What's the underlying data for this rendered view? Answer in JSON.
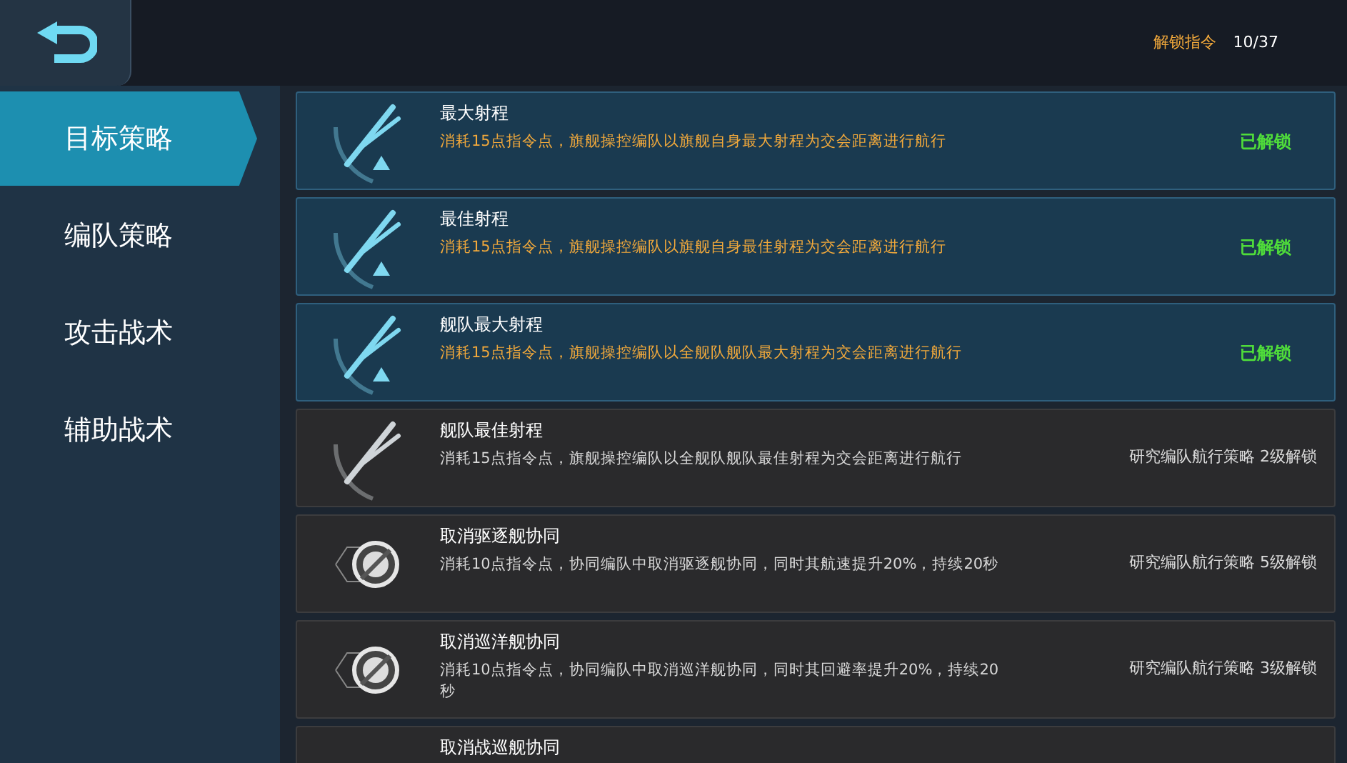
{
  "header": {
    "unlock_label": "解锁指令",
    "unlock_count": "10/37"
  },
  "sidebar": {
    "items": [
      {
        "label": "目标策略",
        "selected": true
      },
      {
        "label": "编队策略",
        "selected": false
      },
      {
        "label": "攻击战术",
        "selected": false
      },
      {
        "label": "辅助战术",
        "selected": false
      }
    ]
  },
  "list": [
    {
      "kind": "unlocked",
      "title": "最大射程",
      "description": "消耗15点指令点，旗舰操控编队以旗舰自身最大射程为交会距离进行航行",
      "status": "已解锁"
    },
    {
      "kind": "unlocked",
      "title": "最佳射程",
      "description": "消耗15点指令点，旗舰操控编队以旗舰自身最佳射程为交会距离进行航行",
      "status": "已解锁"
    },
    {
      "kind": "unlocked",
      "title": "舰队最大射程",
      "description": "消耗15点指令点，旗舰操控编队以全舰队舰队最大射程为交会距离进行航行",
      "status": "已解锁"
    },
    {
      "kind": "locked",
      "title": "舰队最佳射程",
      "description": "消耗15点指令点，旗舰操控编队以全舰队舰队最佳射程为交会距离进行航行",
      "status": "研究编队航行策略 2级解锁"
    },
    {
      "kind": "locked",
      "title": "取消驱逐舰协同",
      "description": "消耗10点指令点，协同编队中取消驱逐舰协同，同时其航速提升20%，持续20秒",
      "status": "研究编队航行策略 5级解锁"
    },
    {
      "kind": "locked",
      "title": "取消巡洋舰协同",
      "description": "消耗10点指令点，协同编队中取消巡洋舰协同，同时其回避率提升20%，持续20秒",
      "status": "研究编队航行策略 3级解锁"
    },
    {
      "kind": "locked",
      "title": "取消战巡舰协同"
    }
  ]
}
